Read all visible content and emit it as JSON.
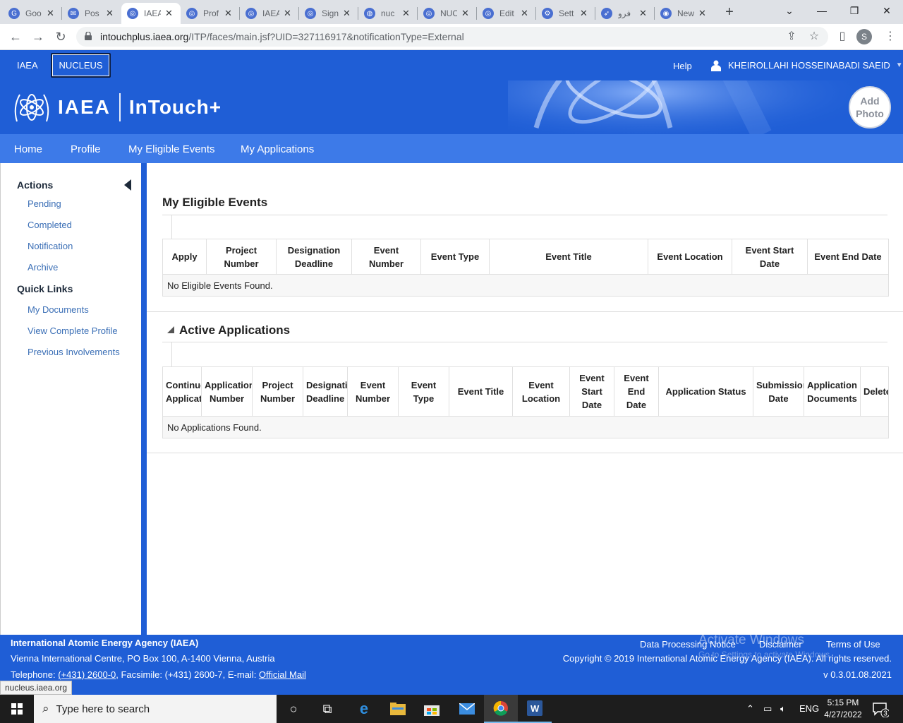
{
  "browser": {
    "tabs": [
      {
        "title": "Goo",
        "icon": "google-icon"
      },
      {
        "title": "Pos",
        "icon": "mail-icon"
      },
      {
        "title": "IAEA",
        "icon": "iaea-icon",
        "active": true
      },
      {
        "title": "Prof",
        "icon": "iaea-icon"
      },
      {
        "title": "IAEA",
        "icon": "iaea-icon"
      },
      {
        "title": "Sign",
        "icon": "iaea-icon"
      },
      {
        "title": "nuc",
        "icon": "globe-icon"
      },
      {
        "title": "NUC",
        "icon": "iaea-icon"
      },
      {
        "title": "Edit",
        "icon": "iaea-icon"
      },
      {
        "title": "Sett",
        "icon": "gear-icon"
      },
      {
        "title": "فرو",
        "icon": "bird-icon"
      },
      {
        "title": "New",
        "icon": "chrome-icon"
      }
    ],
    "new_tab": "+",
    "url_host": "intouchplus.iaea.org",
    "url_path": "/ITP/faces/main.jsf?UID=327116917&notificationType=External",
    "profile_initial": "S"
  },
  "site": {
    "topnav": {
      "iaea": "IAEA",
      "nucleus": "NUCLEUS",
      "help": "Help",
      "user": "KHEIROLLAHI HOSSEINABADI SAEID"
    },
    "logo_text": "IAEA",
    "app_name": "InTouch+",
    "add_photo": [
      "Add",
      "Photo"
    ],
    "mainnav": [
      "Home",
      "Profile",
      "My Eligible Events",
      "My Applications"
    ]
  },
  "sidebar": {
    "actions_title": "Actions",
    "actions": [
      "Pending",
      "Completed",
      "Notification",
      "Archive"
    ],
    "quicklinks_title": "Quick Links",
    "quicklinks": [
      "My Documents",
      "View Complete Profile",
      "Previous Involvements"
    ]
  },
  "eligible": {
    "title": "My Eligible Events",
    "columns": [
      [
        "Apply"
      ],
      [
        "Project",
        "Number"
      ],
      [
        "Designation",
        "Deadline"
      ],
      [
        "Event",
        "Number"
      ],
      [
        "Event Type"
      ],
      [
        "Event Title"
      ],
      [
        "Event Location"
      ],
      [
        "Event Start",
        "Date"
      ],
      [
        "Event End Date"
      ]
    ],
    "empty": "No Eligible Events Found."
  },
  "active": {
    "title": "Active Applications",
    "columns": [
      [
        "Continue",
        "Application"
      ],
      [
        "Application",
        "Number"
      ],
      [
        "Project",
        "Number"
      ],
      [
        "Designation",
        "Deadline"
      ],
      [
        "Event",
        "Number"
      ],
      [
        "Event",
        "Type"
      ],
      [
        "Event Title"
      ],
      [
        "Event",
        "Location"
      ],
      [
        "Event",
        "Start",
        "Date"
      ],
      [
        "Event",
        "End",
        "Date"
      ],
      [
        "Application Status"
      ],
      [
        "Submission",
        "Date"
      ],
      [
        "Application",
        "Documents"
      ],
      [
        "Delete"
      ]
    ],
    "empty": "No Applications Found."
  },
  "footer": {
    "org": "International Atomic Energy Agency (IAEA)",
    "address": "Vienna International Centre, PO Box 100, A-1400 Vienna, Austria",
    "tel_prefix": "Telephone: ",
    "tel": "(+431) 2600-0",
    "fax": ", Facsimile: (+431) 2600-7, E-mail: ",
    "mail": "Official Mail",
    "links": [
      "Data Processing Notice",
      "Disclaimer",
      "Terms of Use"
    ],
    "copyright": "Copyright © 2019 International Atomic Energy Agency (IAEA). All rights reserved.",
    "version": "v 0.3.01.08.2021",
    "watermark": "Activate Windows",
    "watermark_sub": "Go to Settings to activate Windows."
  },
  "status_url": "nucleus.iaea.org",
  "taskbar": {
    "search_placeholder": "Type here to search",
    "lang": "ENG",
    "time": "5:15 PM",
    "date": "4/27/2022",
    "notif_count": "3"
  },
  "colors": {
    "brand_blue": "#1f5ed6",
    "nav_blue": "#3d7ae8",
    "link_blue": "#3b6fb6"
  }
}
